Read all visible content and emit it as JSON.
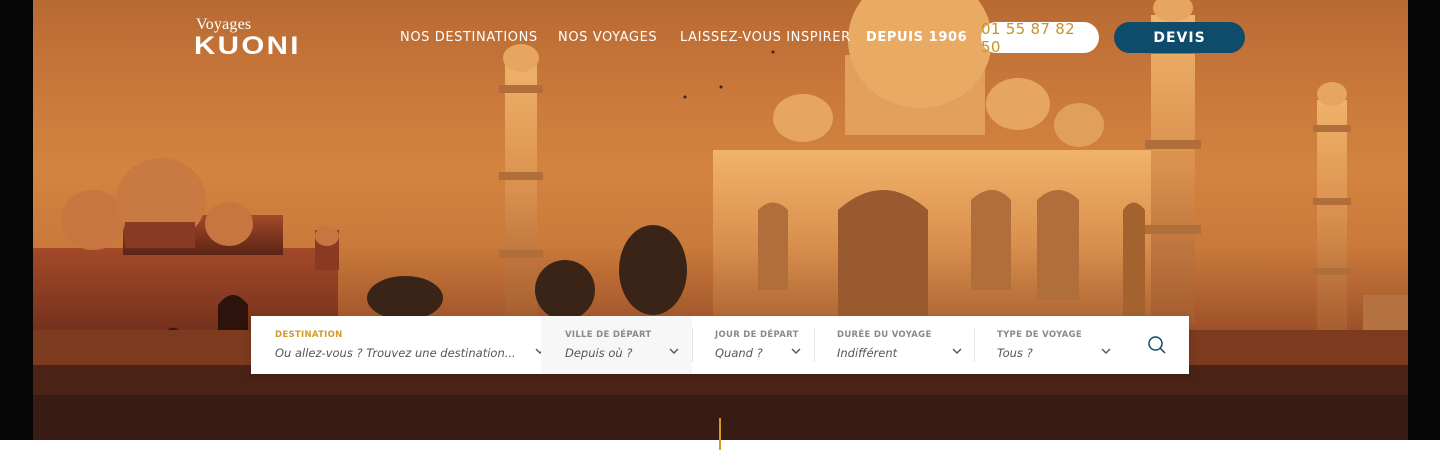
{
  "header": {
    "logo_small": "Voyages",
    "logo_big": "KUONI",
    "nav": [
      {
        "label": "NOS DESTINATIONS"
      },
      {
        "label": "NOS VOYAGES"
      },
      {
        "label": "LAISSEZ-VOUS INSPIRER"
      },
      {
        "label": "DEPUIS 1906"
      }
    ],
    "phone": "01 55 87 82 50",
    "devis": "DEVIS"
  },
  "search": {
    "destination": {
      "label": "DESTINATION",
      "placeholder": "Ou allez-vous ? Trouvez une destination..."
    },
    "ville": {
      "label": "VILLE DE DÉPART",
      "value": "Depuis où ?"
    },
    "jour": {
      "label": "JOUR DE DÉPART",
      "value": "Quand ?"
    },
    "duree": {
      "label": "DURÉE DU VOYAGE",
      "value": "Indifférent"
    },
    "type": {
      "label": "TYPE DE VOYAGE",
      "value": "Tous ?"
    }
  },
  "colors": {
    "accent_gold": "#d39a2a",
    "devis_blue": "#0f4c6b",
    "phone_text": "#c8912a"
  },
  "icons": [
    "search-icon",
    "chevron-down-icon"
  ]
}
